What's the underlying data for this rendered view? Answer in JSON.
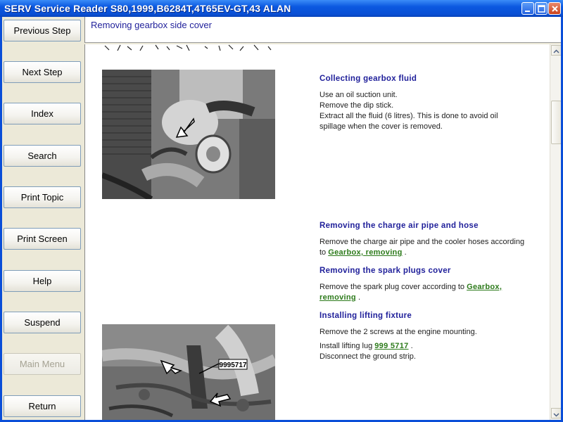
{
  "window": {
    "title": "SERV Service Reader S80,1999,B6284T,4T65EV-GT,43 ALAN"
  },
  "nav": {
    "buttons": [
      {
        "label": "Previous Step",
        "enabled": true
      },
      {
        "label": "Next Step",
        "enabled": true
      },
      {
        "label": "Index",
        "enabled": true
      },
      {
        "label": "Search",
        "enabled": true
      },
      {
        "label": "Print Topic",
        "enabled": true
      },
      {
        "label": "Print Screen",
        "enabled": true
      },
      {
        "label": "Help",
        "enabled": true
      },
      {
        "label": "Suspend",
        "enabled": true
      },
      {
        "label": "Main Menu",
        "enabled": false
      },
      {
        "label": "Return",
        "enabled": true
      }
    ]
  },
  "header": {
    "title": "Removing gearbox side cover"
  },
  "sections": {
    "collecting": {
      "title": "Collecting gearbox fluid",
      "line1": "Use an oil suction unit.",
      "line2": "Remove the dip stick.",
      "line3": "Extract all the fluid (6 litres). This is done to avoid oil",
      "line4": "spillage when the cover is removed."
    },
    "charge_air": {
      "title": "Removing the charge air pipe and hose",
      "line1": "Remove the charge air pipe and the cooler hoses according",
      "line2_prefix": "to ",
      "link": "Gearbox, removing",
      "line2_suffix": " ."
    },
    "spark_plugs": {
      "title": "Removing the spark plugs cover",
      "line1_prefix": "Remove the spark plug cover according to ",
      "link_part1": "Gearbox,",
      "link_part2": "removing",
      "line2_suffix": " ."
    },
    "lifting": {
      "title": "Installing lifting fixture",
      "line1": "Remove the 2 screws at the engine mounting.",
      "line2_prefix": "Install lifting lug ",
      "link": "999 5717",
      "line2_suffix": " .",
      "line3": "Disconnect the ground strip."
    }
  },
  "photo2": {
    "tool_label": "9995717"
  },
  "colors": {
    "title_bar": "#0b58e0",
    "section_title": "#1f1f9a",
    "link": "#2c7a1a"
  }
}
